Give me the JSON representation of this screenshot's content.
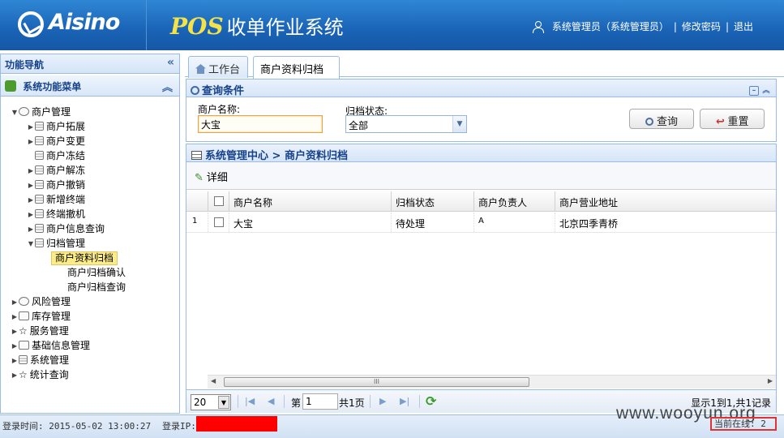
{
  "header": {
    "brand": "Aisino",
    "system_prefix": "POS",
    "system_title": "收单作业系统",
    "user": "系统管理员（系统管理员）",
    "change_password": "修改密码",
    "logout": "退出",
    "separator": "|"
  },
  "sidebar": {
    "nav_title": "功能导航",
    "collapse_glyph": "«",
    "menu_title": "系统功能菜单",
    "menu_toggle_glyph": "︽",
    "tree": [
      {
        "label": "商户管理",
        "level": 1,
        "expanded": true,
        "icon": "user-group-icon"
      },
      {
        "label": "商户拓展",
        "level": 2,
        "icon": "document-icon"
      },
      {
        "label": "商户变更",
        "level": 2,
        "icon": "document-icon"
      },
      {
        "label": "商户冻结",
        "level": 2,
        "icon": "document-icon"
      },
      {
        "label": "商户解冻",
        "level": 2,
        "icon": "document-icon"
      },
      {
        "label": "商户撤销",
        "level": 2,
        "icon": "document-icon"
      },
      {
        "label": "新增终端",
        "level": 2,
        "icon": "document-icon"
      },
      {
        "label": "终端撤机",
        "level": 2,
        "icon": "document-icon"
      },
      {
        "label": "商户信息查询",
        "level": 2,
        "icon": "document-icon"
      },
      {
        "label": "归档管理",
        "level": 2,
        "expanded": true,
        "icon": "document-icon"
      },
      {
        "label": "商户资料归档",
        "level": 3,
        "selected": true
      },
      {
        "label": "商户归档确认",
        "level": 3
      },
      {
        "label": "商户归档查询",
        "level": 3
      },
      {
        "label": "风险管理",
        "level": 1,
        "icon": "coin-icon"
      },
      {
        "label": "库存管理",
        "level": 1,
        "icon": "inbox-icon"
      },
      {
        "label": "服务管理",
        "level": 1,
        "icon": "star-icon"
      },
      {
        "label": "基础信息管理",
        "level": 1,
        "icon": "monitor-icon"
      },
      {
        "label": "系统管理",
        "level": 1,
        "icon": "document-icon"
      },
      {
        "label": "统计查询",
        "level": 1,
        "icon": "star-icon"
      }
    ]
  },
  "tabs": {
    "home": "工作台",
    "active": "商户资料归档",
    "close_glyph": "×"
  },
  "query": {
    "title": "查询条件",
    "name_label": "商户名称:",
    "name_value": "大宝",
    "status_label": "归档状态:",
    "status_value": "全部",
    "search_button": "查询",
    "reset_button": "重置"
  },
  "grid": {
    "breadcrumb": "系统管理中心 > 商户资料归档",
    "detail_button": "详细",
    "columns": [
      "商户名称",
      "归档状态",
      "商户负责人",
      "商户营业地址"
    ],
    "rows": [
      {
        "index": "1",
        "name": "大宝",
        "status": "待处理",
        "owner": "A",
        "address": "北京四季青桥"
      }
    ],
    "scroll_grip": "III"
  },
  "pager": {
    "page_size": "20",
    "page_prefix": "第",
    "page_value": "1",
    "page_total": "共1页",
    "info": "显示1到1,共1记录"
  },
  "statusbar": {
    "login_time": "登录时间: 2015-05-02 13:00:27",
    "login_ip_label": "登录IP:",
    "online": "当前在线: 2",
    "watermark": "www.wooyun.org"
  }
}
